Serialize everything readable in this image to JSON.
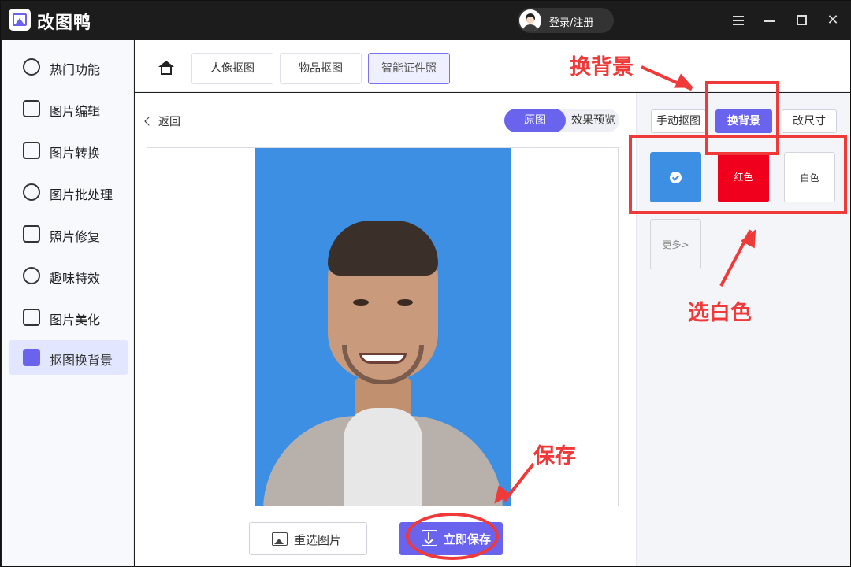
{
  "app": {
    "title": "改图鸭",
    "login_label": "登录/注册"
  },
  "sidebar": {
    "items": [
      {
        "label": "热门功能",
        "icon": "fire-icon"
      },
      {
        "label": "图片编辑",
        "icon": "image-edit-icon"
      },
      {
        "label": "图片转换",
        "icon": "convert-icon"
      },
      {
        "label": "图片批处理",
        "icon": "batch-icon"
      },
      {
        "label": "照片修复",
        "icon": "repair-icon"
      },
      {
        "label": "趣味特效",
        "icon": "magic-wand-icon"
      },
      {
        "label": "图片美化",
        "icon": "beautify-icon"
      },
      {
        "label": "抠图换背景",
        "icon": "cutout-icon",
        "active": true
      }
    ]
  },
  "topnav": {
    "tabs": [
      {
        "label": "人像抠图"
      },
      {
        "label": "物品抠图"
      },
      {
        "label": "智能证件照",
        "active": true
      }
    ]
  },
  "main": {
    "back_label": "返回",
    "toggle": {
      "on_label": "原图",
      "off_label": "效果预览"
    },
    "reselect_label": "重选图片",
    "save_label": "立即保存"
  },
  "right_panel": {
    "tabs": [
      {
        "label": "手动抠图"
      },
      {
        "label": "换背景",
        "active": true
      },
      {
        "label": "改尺寸"
      }
    ],
    "swatches": [
      {
        "label": "",
        "color": "#3d8fe3",
        "selected": true
      },
      {
        "label": "红色",
        "color": "#f0001c"
      },
      {
        "label": "白色",
        "color": "#ffffff"
      }
    ],
    "more_label": "更多>"
  },
  "annotations": {
    "change_bg": "换背景",
    "pick_white": "选白色",
    "save": "保存",
    "color": "#f03a3a"
  },
  "colors": {
    "accent": "#6a63ee",
    "photo_bg": "#3d8fe3"
  }
}
